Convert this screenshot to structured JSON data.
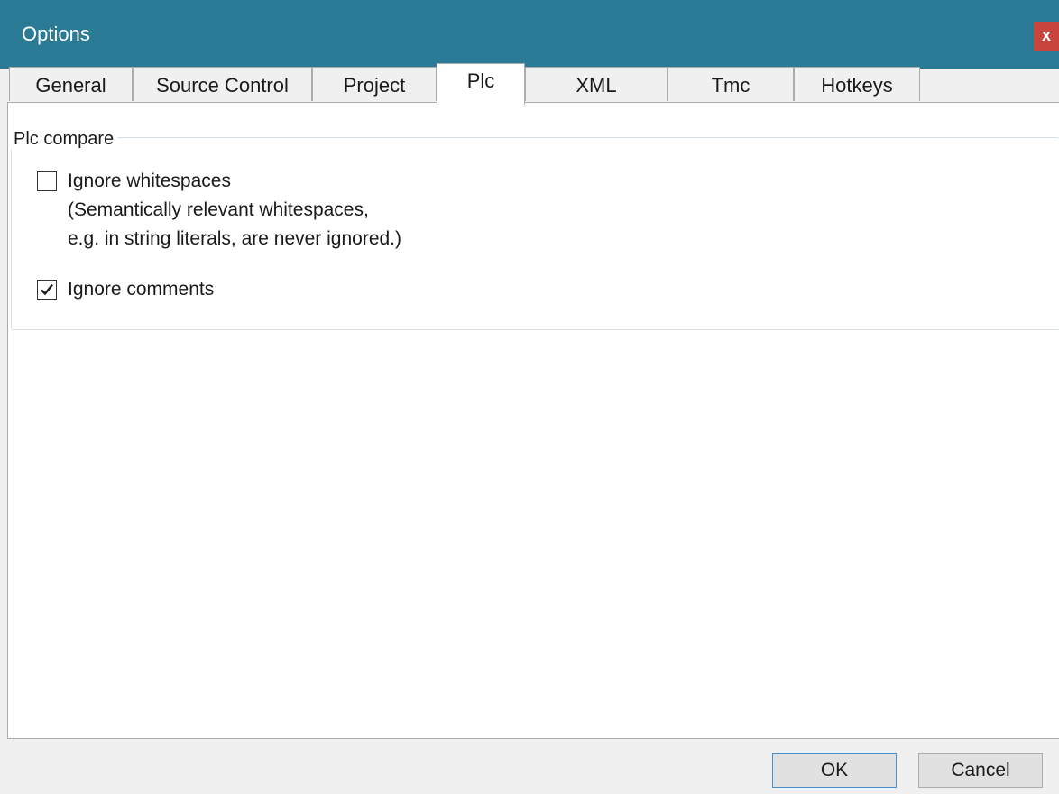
{
  "window": {
    "title": "Options",
    "close_label": "x",
    "titlebar_color": "#2b7a96",
    "close_color": "#c9453e"
  },
  "tabs": [
    {
      "label": "General",
      "active": false
    },
    {
      "label": "Source Control",
      "active": false
    },
    {
      "label": "Project",
      "active": false
    },
    {
      "label": "Plc",
      "active": true
    },
    {
      "label": "XML",
      "active": false
    },
    {
      "label": "Tmc",
      "active": false
    },
    {
      "label": "Hotkeys",
      "active": false
    }
  ],
  "plc_compare": {
    "group_title": "Plc compare",
    "ignore_whitespaces": {
      "label": "Ignore whitespaces",
      "note_line1": "(Semantically relevant whitespaces,",
      "note_line2": "e.g. in string literals, are never ignored.)",
      "checked": false
    },
    "ignore_comments": {
      "label": "Ignore comments",
      "checked": true
    }
  },
  "buttons": {
    "ok_label": "OK",
    "cancel_label": "Cancel"
  }
}
